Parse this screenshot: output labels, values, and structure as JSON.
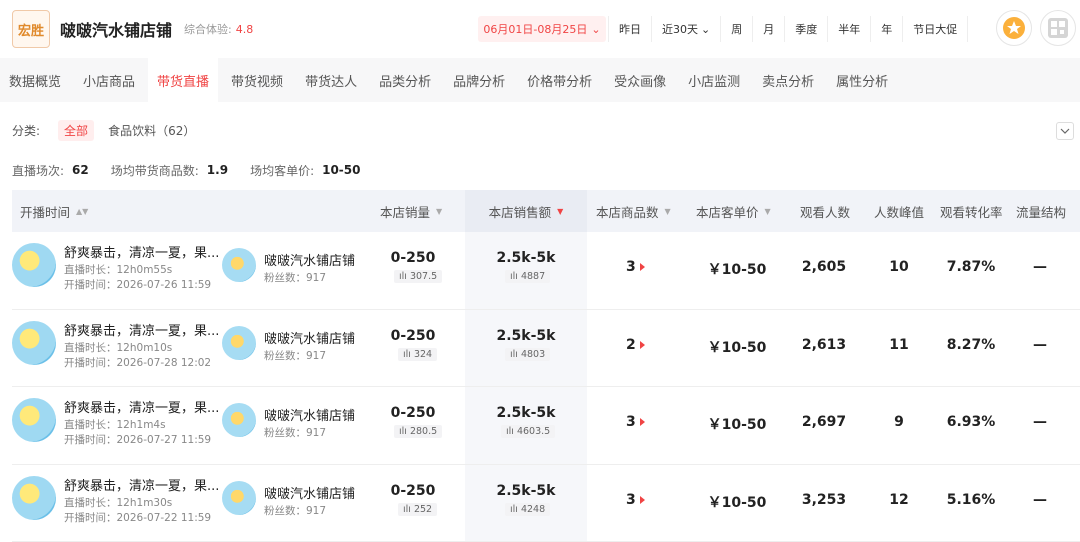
{
  "header": {
    "logo_text": "宏胜",
    "store_name": "啵啵汽水铺店铺",
    "score_label": "综合体验:",
    "score_value": "4.8",
    "date_range": "06月01日-08月25日",
    "periods": [
      "昨日",
      "近30天",
      "周",
      "月",
      "季度",
      "半年",
      "年",
      "节日大促"
    ]
  },
  "tabs": [
    "数据概览",
    "小店商品",
    "带货直播",
    "带货视频",
    "带货达人",
    "品类分析",
    "品牌分析",
    "价格带分析",
    "受众画像",
    "小店监测",
    "卖点分析",
    "属性分析"
  ],
  "active_tab": "带货直播",
  "filter": {
    "label": "分类:",
    "all": "全部",
    "category": "食品饮料（62）"
  },
  "stats": {
    "sessions_label": "直播场次:",
    "sessions": "62",
    "goods_label": "场均带货商品数:",
    "goods": "1.9",
    "price_label": "场均客单价:",
    "price": "10-50"
  },
  "table": {
    "headers": [
      "开播时间",
      "本店销量",
      "本店销售额",
      "本店商品数",
      "本店客单价",
      "观看人数",
      "人数峰值",
      "观看转化率",
      "流量结构"
    ],
    "rows": [
      {
        "title": "舒爽暴击，清凉一夏，果...",
        "duration": "直播时长：12h0m55s",
        "start": "开播时间：2026-07-26 11:59",
        "anchor": "啵啵汽水铺店铺",
        "fans": "粉丝数：917",
        "sales": "0-250",
        "sales_mini": "307.5",
        "revenue": "2.5k-5k",
        "revenue_mini": "4887",
        "goods": "3",
        "price": "￥10-50",
        "viewers": "2,605",
        "peak": "10",
        "conv": "7.87%",
        "traffic": "—"
      },
      {
        "title": "舒爽暴击，清凉一夏，果...",
        "duration": "直播时长：12h0m10s",
        "start": "开播时间：2026-07-28 12:02",
        "anchor": "啵啵汽水铺店铺",
        "fans": "粉丝数：917",
        "sales": "0-250",
        "sales_mini": "324",
        "revenue": "2.5k-5k",
        "revenue_mini": "4803",
        "goods": "2",
        "price": "￥10-50",
        "viewers": "2,613",
        "peak": "11",
        "conv": "8.27%",
        "traffic": "—"
      },
      {
        "title": "舒爽暴击，清凉一夏，果...",
        "duration": "直播时长：12h1m4s",
        "start": "开播时间：2026-07-27 11:59",
        "anchor": "啵啵汽水铺店铺",
        "fans": "粉丝数：917",
        "sales": "0-250",
        "sales_mini": "280.5",
        "revenue": "2.5k-5k",
        "revenue_mini": "4603.5",
        "goods": "3",
        "price": "￥10-50",
        "viewers": "2,697",
        "peak": "9",
        "conv": "6.93%",
        "traffic": "—"
      },
      {
        "title": "舒爽暴击，清凉一夏，果...",
        "duration": "直播时长：12h1m30s",
        "start": "开播时间：2026-07-22 11:59",
        "anchor": "啵啵汽水铺店铺",
        "fans": "粉丝数：917",
        "sales": "0-250",
        "sales_mini": "252",
        "revenue": "2.5k-5k",
        "revenue_mini": "4248",
        "goods": "3",
        "price": "￥10-50",
        "viewers": "3,253",
        "peak": "12",
        "conv": "5.16%",
        "traffic": "—"
      }
    ]
  },
  "colors": {
    "accent": "#f04444",
    "tab_bg": "#f7f7f8",
    "header_bg": "#f1f3f8"
  }
}
